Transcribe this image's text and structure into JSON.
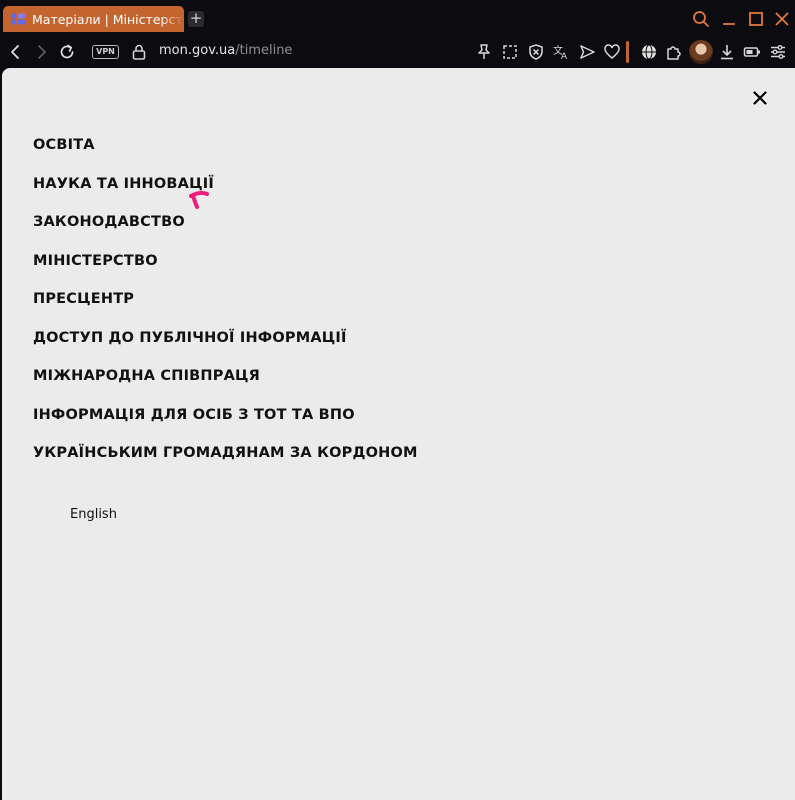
{
  "browser": {
    "tab": {
      "title": "Матеріали | Міністерство освіти і науки України",
      "favicon": "mon-logo-icon"
    },
    "address": {
      "host": "mon.gov.ua",
      "path": "/timeline"
    },
    "vpn_label": "VPN",
    "accent_color": "#c4652f"
  },
  "menu": {
    "items": [
      {
        "label": "ОСВІТА"
      },
      {
        "label": "НАУКА ТА ІННОВАЦІЇ"
      },
      {
        "label": "ЗАКОНОДАВСТВО"
      },
      {
        "label": "МІНІСТЕРСТВО"
      },
      {
        "label": "ПРЕСЦЕНТР"
      },
      {
        "label": "ДОСТУП ДО ПУБЛІЧНОЇ ІНФОРМАЦІЇ"
      },
      {
        "label": "МІЖНАРОДНА СПІВПРАЦЯ"
      },
      {
        "label": "ІНФОРМАЦІЯ ДЛЯ ОСІБ З ТОТ ТА ВПО"
      },
      {
        "label": "УКРАЇНСЬКИМ ГРОМАДЯНАМ ЗА КОРДОНОМ"
      }
    ],
    "language_link": "English"
  }
}
